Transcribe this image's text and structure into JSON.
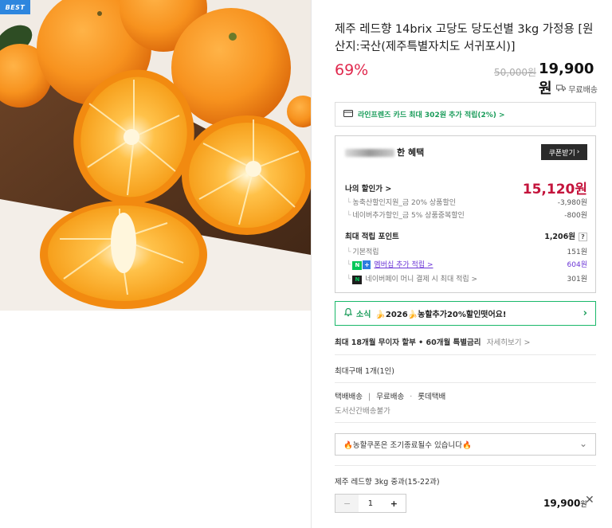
{
  "badge": "BEST",
  "product": {
    "title": "제주 레드향 14brix 고당도 당도선별 3kg 가정용 [원산지:국산(제주특별자치도 서귀포시)]",
    "discount": "69%",
    "original_price": "50,000원",
    "sale_price": "19,900원",
    "shipping": "무료배송"
  },
  "card_promo": "라인프렌즈 카드 최대 302원 추가 적립(2%) >",
  "benefit": {
    "title_suffix": "한 혜택",
    "coupon_button": "쿠폰받기",
    "my_discount_label": "나의 할인가 >",
    "my_discount_value": "15,120원",
    "discounts": [
      {
        "label": "농축산할인지원_금 20% 상품할인",
        "value": "-3,980원"
      },
      {
        "label": "네이버추가할인_금 5% 상품중복할인",
        "value": "-800원"
      }
    ],
    "points_label": "최대 적립 포인트",
    "points_value": "1,206원",
    "points_help": "?",
    "basic_label": "기본적립",
    "basic_value": "151원",
    "membership_label": "멤버십 추가 적립 >",
    "membership_value": "604원",
    "npay_label": "네이버페이 머니 결제 시 최대 적립 >",
    "npay_value": "301원"
  },
  "notice": {
    "label": "소식",
    "text": "🍌2026🍌농할추가20%할인떳어요!"
  },
  "installment": {
    "text": "최대 18개월 무이자 할부 • 60개월 특별금리",
    "link": "자세히보기 >"
  },
  "max_purchase": "최대구매 1개(1인)",
  "delivery": {
    "line1_a": "택배배송",
    "line1_b": "무료배송",
    "line1_c": "롯데택배",
    "line2": "도서산간배송불가"
  },
  "coupon_select": "🔥농할쿠폰은 조기종료될수 있습니다🔥",
  "option": {
    "name": "제주 레드향 3kg 중과(15-22과)",
    "qty": "1",
    "price_num": "19,900",
    "price_unit": "원"
  },
  "icons": {
    "shipping": "truck-icon",
    "card": "credit-card-icon",
    "notice": "bell-icon",
    "chevron": "chevron-right-icon",
    "dropdown": "chevron-down-icon",
    "close": "close-icon"
  },
  "colors": {
    "discount": "#e0284d",
    "green": "#1a9c5a",
    "best_badge": "#2e86de",
    "benefit_price": "#c4143c",
    "purple": "#6b35d6"
  }
}
